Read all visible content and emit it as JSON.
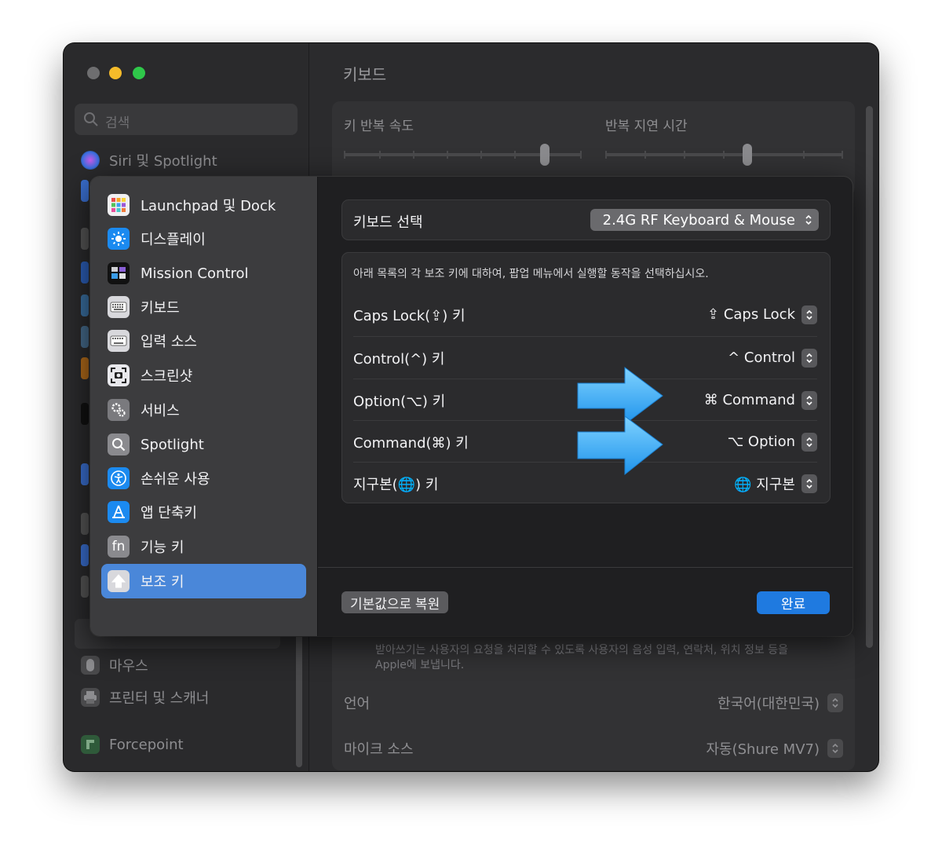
{
  "window": {
    "sidebar": {
      "search_placeholder": "검색",
      "items": [
        {
          "label": "Siri 및 Spotlight",
          "icon": "siri-icon"
        },
        {
          "label": "마우스",
          "icon": "mouse-icon"
        },
        {
          "label": "프린터 및 스캐너",
          "icon": "printer-icon"
        },
        {
          "label": "Forcepoint",
          "icon": "forcepoint-icon"
        }
      ]
    },
    "main": {
      "title": "키보드",
      "key_repeat_label": "키 반복 속도",
      "repeat_delay_label": "반복 지연 시간",
      "dictation_note_line1": "받아쓰기는 사용자의 요청을 처리할 수 있도록 사용자의 음성 입력, 연락처, 위치 정보 등을",
      "dictation_note_line2": "Apple에 보냅니다.",
      "language_label": "언어",
      "language_value": "한국어(대한민국)",
      "mic_label": "마이크 소스",
      "mic_value": "자동(Shure MV7)"
    }
  },
  "sheet": {
    "sidebar_items": [
      {
        "label": "Launchpad 및 Dock",
        "icon": "launchpad-icon"
      },
      {
        "label": "디스플레이",
        "icon": "display-icon"
      },
      {
        "label": "Mission Control",
        "icon": "mission-control-icon"
      },
      {
        "label": "키보드",
        "icon": "keyboard-icon"
      },
      {
        "label": "입력 소스",
        "icon": "input-source-icon"
      },
      {
        "label": "스크린샷",
        "icon": "screenshot-icon"
      },
      {
        "label": "서비스",
        "icon": "services-icon"
      },
      {
        "label": "Spotlight",
        "icon": "spotlight-icon"
      },
      {
        "label": "손쉬운 사용",
        "icon": "accessibility-icon"
      },
      {
        "label": "앱 단축키",
        "icon": "app-shortcuts-icon"
      },
      {
        "label": "기능 키",
        "icon": "function-keys-icon",
        "glyph": "fn"
      },
      {
        "label": "보조 키",
        "icon": "modifier-keys-icon",
        "selected": true
      }
    ],
    "keyboard_select_label": "키보드 선택",
    "keyboard_select_value": "2.4G RF Keyboard & Mouse",
    "description": "아래 목록의 각 보조 키에 대하여, 팝업 메뉴에서 실행할 동작을 선택하십시오.",
    "modifiers": [
      {
        "key": "Caps Lock(⇪) 키",
        "value": "⇪ Caps Lock"
      },
      {
        "key": "Control(^) 키",
        "value": "^ Control"
      },
      {
        "key": "Option(⌥) 키",
        "value": "⌘ Command"
      },
      {
        "key": "Command(⌘) 키",
        "value": "⌥ Option"
      },
      {
        "key": "지구본(🌐) 키",
        "value": "🌐 지구본"
      }
    ],
    "reset_button": "기본값으로 복원",
    "done_button": "완료"
  },
  "colors": {
    "accent": "#1f7ae0",
    "selection": "#4a87d9",
    "arrow": "#2ea6f2"
  }
}
